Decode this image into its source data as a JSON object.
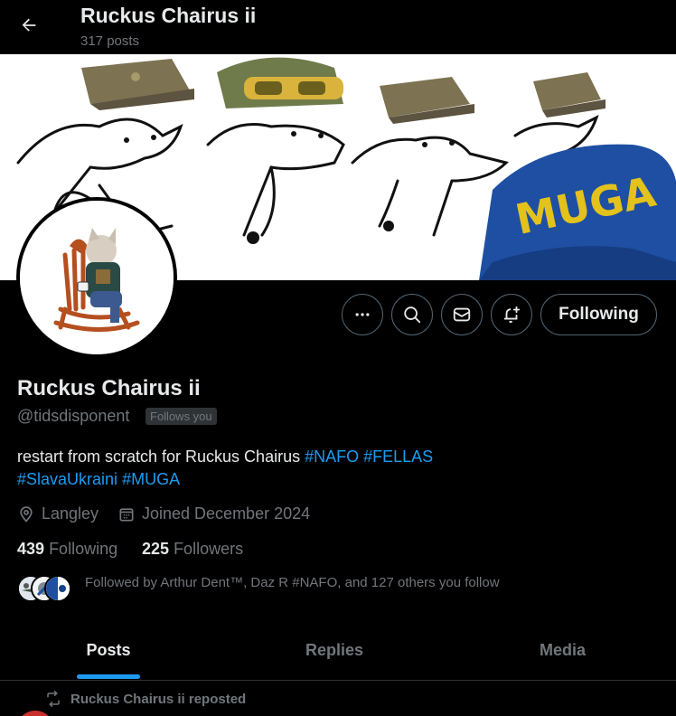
{
  "header": {
    "back_icon": "arrow-left-icon",
    "title": "Ruckus Chairus ii",
    "post_count": "317 posts"
  },
  "banner": {
    "hat_text": "MUGA",
    "hat_color": "#1e4fa3",
    "hat_text_color": "#e3c21c"
  },
  "actions": {
    "more_icon": "more-icon",
    "search_icon": "search-icon",
    "message_icon": "mail-icon",
    "notify_icon": "bell-plus-icon",
    "follow_label": "Following"
  },
  "profile": {
    "name": "Ruckus Chairus ii",
    "handle": "@tidsdisponent",
    "follows_you": "Follows you",
    "bio_text": "restart from scratch for Ruckus Chairus ",
    "bio_tags_line1": [
      "#NAFO",
      "#FELLAS"
    ],
    "bio_tags_line2": [
      "#SlavaUkraini",
      "#MUGA"
    ],
    "location": "Langley",
    "joined": "Joined December 2024",
    "following_count": "439",
    "following_label": "Following",
    "followers_count": "225",
    "followers_label": "Followers",
    "followed_by": "Followed by Arthur Dent™, Daz R #NAFO, and 127 others you follow"
  },
  "tabs": [
    {
      "label": "Posts",
      "active": true
    },
    {
      "label": "Replies",
      "active": false
    },
    {
      "label": "Media",
      "active": false
    }
  ],
  "timeline": {
    "repost_label": "Ruckus Chairus ii reposted"
  },
  "colors": {
    "accent": "#1d9bf0",
    "muted": "#71767b",
    "text": "#e7e9ea",
    "border": "#536471"
  }
}
